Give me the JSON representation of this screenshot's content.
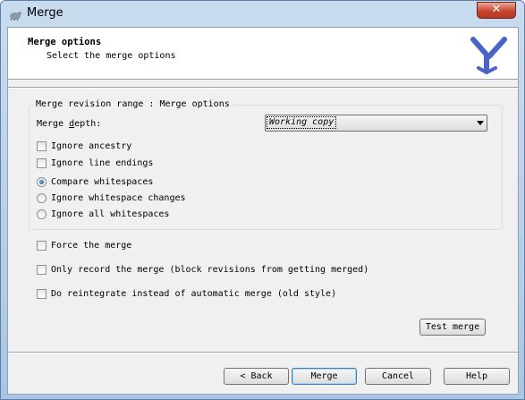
{
  "window": {
    "title": "Merge",
    "close_glyph": "✕",
    "icon": "tortoise-icon"
  },
  "header": {
    "title": "Merge options",
    "subtitle": "Select the merge options",
    "logo_icon": "merge-fork-icon"
  },
  "group": {
    "legend": "Merge revision range : Merge options",
    "depth_label": "Merge depth:",
    "depth_value": "Working copy"
  },
  "checkboxes_top": [
    {
      "label": "Ignore ancestry",
      "checked": false
    },
    {
      "label": "Ignore line endings",
      "checked": false
    }
  ],
  "radios": [
    {
      "label": "Compare whitespaces",
      "selected": true
    },
    {
      "label": "Ignore whitespace changes",
      "selected": false
    },
    {
      "label": "Ignore all whitespaces",
      "selected": false
    }
  ],
  "checkboxes_bottom": [
    {
      "label": "Force the merge",
      "checked": false
    },
    {
      "label": "Only record the merge (block revisions from getting merged)",
      "checked": false
    },
    {
      "label": "Do reintegrate instead of automatic merge (old style)",
      "checked": false
    }
  ],
  "buttons": {
    "test_merge": "Test merge",
    "back": "< Back",
    "merge": "Merge",
    "cancel": "Cancel",
    "help": "Help"
  },
  "colors": {
    "titlebar": "#b8cfe8",
    "close": "#c7452f",
    "logo": "#4a63c8",
    "focus": "#3c7fb1"
  }
}
